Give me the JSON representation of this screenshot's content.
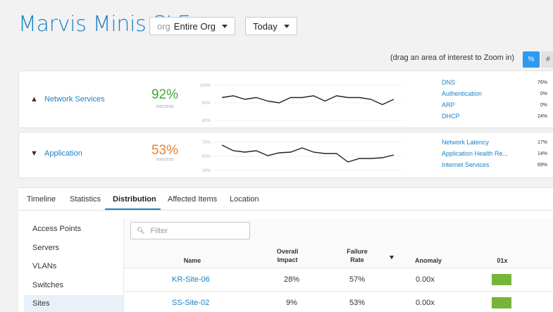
{
  "header": {
    "title": "Marvis Minis SLE",
    "org_prefix": "org",
    "org_value": "Entire Org",
    "date_value": "Today"
  },
  "zoom_hint": "(drag an area of interest to Zoom in)",
  "toggle": {
    "percent": "%",
    "hash": "#",
    "active": "percent"
  },
  "cards": [
    {
      "name": "Network Services",
      "expanded": true,
      "value": "92%",
      "value_label": "success",
      "color": "#3aaa35",
      "axis": [
        "100%",
        "90%",
        "80%"
      ],
      "trend": [
        93,
        94,
        92,
        93,
        91,
        90,
        93,
        93,
        94,
        91,
        94,
        93,
        93,
        92,
        89,
        92
      ],
      "trend_range": [
        80,
        100
      ],
      "metrics": [
        {
          "label": "DNS",
          "value": "76%"
        },
        {
          "label": "Authentication",
          "value": "0%"
        },
        {
          "label": "ARP",
          "value": "0%"
        },
        {
          "label": "DHCP",
          "value": "24%"
        }
      ]
    },
    {
      "name": "Application",
      "expanded": false,
      "value": "53%",
      "value_label": "success",
      "color": "#e8822e",
      "axis": [
        "70%",
        "50%",
        "30%"
      ],
      "trend": [
        66,
        58,
        56,
        58,
        51,
        55,
        56,
        62,
        56,
        54,
        54,
        42,
        47,
        47,
        48,
        52
      ],
      "trend_range": [
        30,
        70
      ],
      "metrics": [
        {
          "label": "Network Latency",
          "value": "17%"
        },
        {
          "label": "Application Health Re...",
          "value": "14%"
        },
        {
          "label": "Internet Services",
          "value": "69%"
        }
      ]
    }
  ],
  "tabs": [
    "Timeline",
    "Statistics",
    "Distribution",
    "Affected Items",
    "Location"
  ],
  "active_tab": "Distribution",
  "sidebar": [
    "Access Points",
    "Servers",
    "VLANs",
    "Switches",
    "Sites"
  ],
  "active_sidebar": "Sites",
  "filter_placeholder": "Filter",
  "table": {
    "headers": {
      "name": "Name",
      "impact_1": "Overall",
      "impact_2": "Impact",
      "failure_1": "Failure",
      "failure_2": "Rate",
      "anomaly": "Anomaly",
      "ox": "01x"
    },
    "rows": [
      {
        "name": "KR-Site-06",
        "impact": "28%",
        "failure": "57%",
        "anomaly": "0.00x",
        "bar_color": "#77b53a"
      },
      {
        "name": "SS-Site-02",
        "impact": "9%",
        "failure": "53%",
        "anomaly": "0.00x",
        "bar_color": "#77b53a"
      }
    ]
  }
}
